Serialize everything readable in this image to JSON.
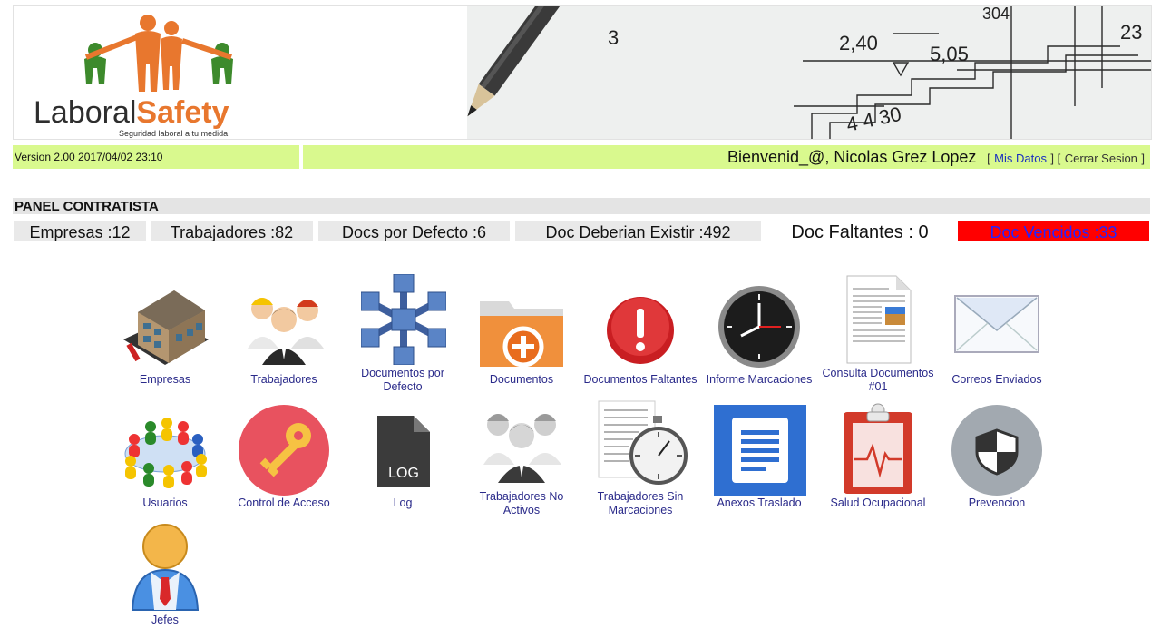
{
  "header": {
    "logo_word1": "Laboral",
    "logo_word2": "Safety",
    "logo_tagline": "Seguridad laboral a tu medida",
    "banner_figures": [
      "2,40",
      "5,05",
      "3",
      "23",
      "4 4 30",
      "304"
    ]
  },
  "topbar": {
    "version": "Version 2.00 2017/04/02 23:10",
    "welcome": "Bienvenid_@, Nicolas Grez Lopez",
    "bracket_open1": "[",
    "mis_datos": "Mis Datos",
    "bracket_mid": "] [",
    "cerrar_sesion": "Cerrar Sesion",
    "bracket_close": "]"
  },
  "panel_title": "PANEL CONTRATISTA",
  "stats": {
    "empresas": "Empresas :12",
    "trabajadores": "Trabajadores :82",
    "docs_defecto": "Docs por Defecto :6",
    "doc_deberian": "Doc Deberian Existir :492",
    "doc_faltantes": "Doc Faltantes : 0",
    "doc_vencidos": "Doc Vencidos :33"
  },
  "tiles": {
    "empresas": "Empresas",
    "trabajadores": "Trabajadores",
    "documentos_defecto_1": "Documentos por",
    "documentos_defecto_2": "Defecto",
    "documentos": "Documentos",
    "documentos_faltantes": "Documentos Faltantes",
    "informe_marcaciones": "Informe Marcaciones",
    "consulta_documentos_1": "Consulta Documentos",
    "consulta_documentos_2": "#01",
    "correos_enviados": "Correos Enviados",
    "usuarios": "Usuarios",
    "control_acceso": "Control de Acceso",
    "log": "Log",
    "log_icon_text": "LOG",
    "trab_no_activos_1": "Trabajadores No",
    "trab_no_activos_2": "Activos",
    "trab_sin_marc_1": "Trabajadores Sin",
    "trab_sin_marc_2": "Marcaciones",
    "anexos_traslado": "Anexos Traslado",
    "salud_ocupacional": "Salud Ocupacional",
    "prevencion": "Prevencion",
    "jefes": "Jefes"
  },
  "colors": {
    "topbar": "#d9f98e",
    "logo_orange": "#e8772e",
    "logo_green": "#3d8a2c",
    "alert_red": "#ff0000",
    "link_blue": "#1a2fc0"
  }
}
